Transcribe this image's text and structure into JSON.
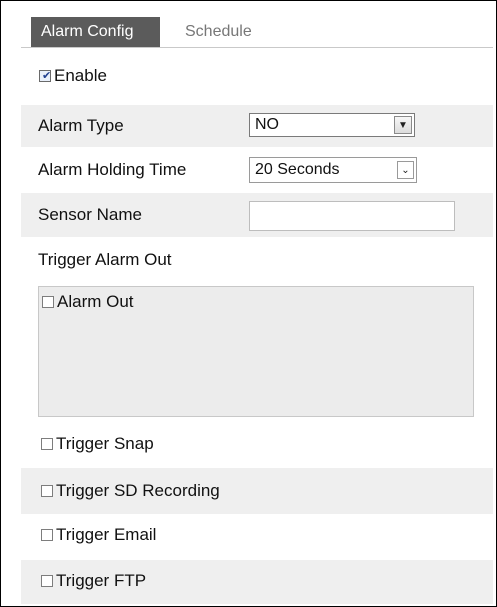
{
  "tabs": {
    "alarm_config": "Alarm Config",
    "schedule": "Schedule"
  },
  "enable": {
    "label": "Enable",
    "checked": true
  },
  "alarm_type": {
    "label": "Alarm Type",
    "value": "NO"
  },
  "alarm_holding_time": {
    "label": "Alarm Holding Time",
    "value": "20 Seconds"
  },
  "sensor_name": {
    "label": "Sensor Name",
    "value": ""
  },
  "trigger_alarm_out": {
    "label": "Trigger Alarm Out",
    "alarm_out_label": "Alarm Out",
    "alarm_out_checked": false
  },
  "triggers": {
    "snap": {
      "label": "Trigger Snap",
      "checked": false
    },
    "sd_recording": {
      "label": "Trigger SD Recording",
      "checked": false
    },
    "email": {
      "label": "Trigger Email",
      "checked": false
    },
    "ftp": {
      "label": "Trigger FTP",
      "checked": false
    }
  },
  "colors": {
    "active_tab_bg": "#5b5b5b",
    "shaded_row_bg": "#efefef",
    "inactive_tab_text": "#777777"
  },
  "icons": {
    "dropdown": "triangle-down",
    "checkbox_checked": "check-mark"
  }
}
